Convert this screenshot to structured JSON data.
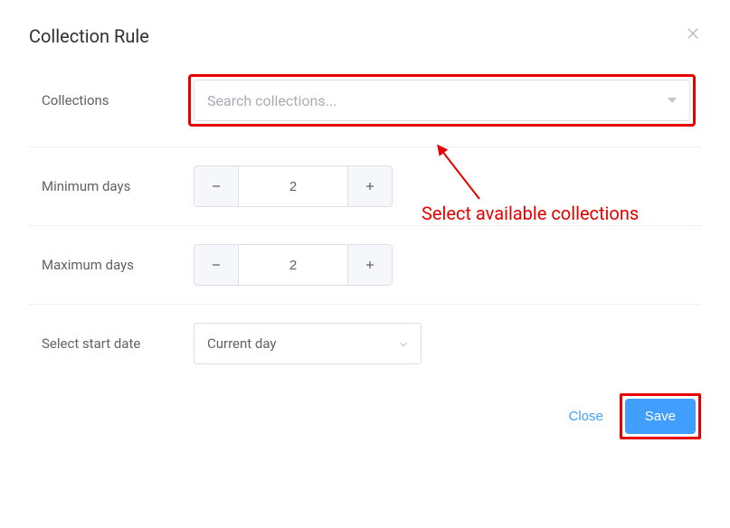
{
  "title": "Collection Rule",
  "fields": {
    "collections": {
      "label": "Collections",
      "placeholder": "Search collections..."
    },
    "min_days": {
      "label": "Minimum days",
      "value": "2"
    },
    "max_days": {
      "label": "Maximum days",
      "value": "2"
    },
    "start_date": {
      "label": "Select start date",
      "value": "Current day"
    }
  },
  "footer": {
    "close": "Close",
    "save": "Save"
  },
  "annotation": {
    "text": "Select available collections"
  }
}
